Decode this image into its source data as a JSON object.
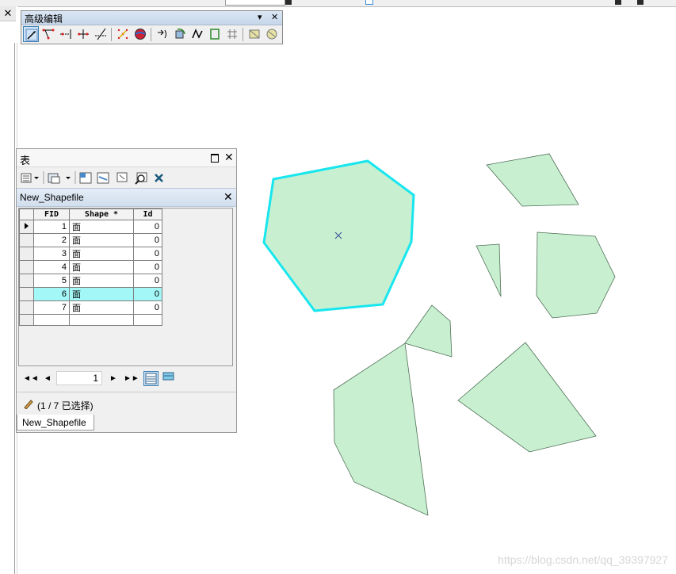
{
  "colors": {
    "polygon_fill": "#c8f0d0",
    "polygon_stroke": "#4f6f57",
    "selected_stroke": "#18e6ef",
    "selected_row": "#a4f7f7",
    "toolbar_selected": "#cfe3f7"
  },
  "advanced_editing": {
    "title": "高级编辑",
    "menu_glyph": "▾",
    "close_glyph": "✕",
    "tools": [
      "edit-tool-icon",
      "line-intersection-icon",
      "extend-icon",
      "trim-icon",
      "fillet-icon",
      "explode-icon",
      "sphere-icon",
      "copy-parallel-icon",
      "rotate-icon",
      "generalize-icon",
      "align-edge-icon",
      "grid-icon",
      "construct-features-icon",
      "merge-icon"
    ]
  },
  "table_window": {
    "title": "表",
    "close_glyph": "✕",
    "layer_tab": "New_Shapefile",
    "layer_close_glyph": "✕",
    "toolbar_icons": [
      "table-options-icon",
      "related-tables-icon",
      "select-by-attributes-icon",
      "switch-selection-icon",
      "clear-selection-icon",
      "zoom-to-selected-icon",
      "delete-selected-icon"
    ],
    "columns": [
      "FID",
      "Shape *",
      "Id"
    ],
    "rows": [
      {
        "fid": "1",
        "shape": "面",
        "id": "0"
      },
      {
        "fid": "2",
        "shape": "面",
        "id": "0"
      },
      {
        "fid": "3",
        "shape": "面",
        "id": "0"
      },
      {
        "fid": "4",
        "shape": "面",
        "id": "0"
      },
      {
        "fid": "5",
        "shape": "面",
        "id": "0"
      },
      {
        "fid": "6",
        "shape": "面",
        "id": "0"
      },
      {
        "fid": "7",
        "shape": "面",
        "id": "0"
      }
    ],
    "selected_row": 5,
    "current_record": "1",
    "nav": {
      "first": "◄◄",
      "prev": "◄",
      "next": "►",
      "last": "►►"
    },
    "status": "(1 / 7 已选择)",
    "bottom_tab": "New_Shapefile"
  },
  "map": {
    "selected_polygon_index": 0,
    "watermark": "https://blog.csdn.net/qq_39397927"
  }
}
